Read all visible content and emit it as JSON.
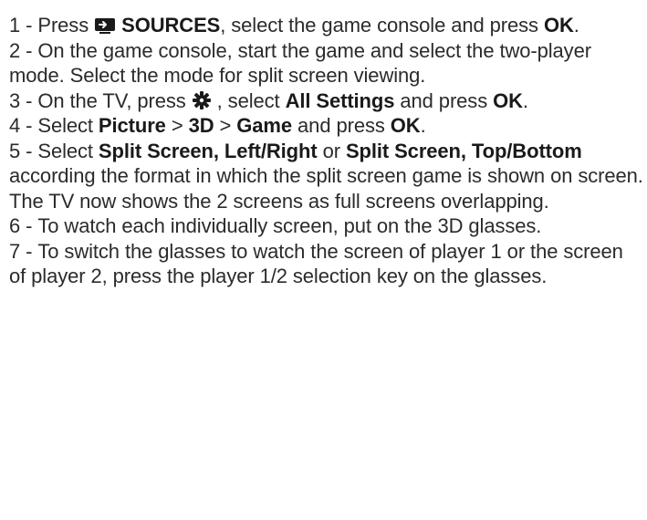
{
  "steps": [
    {
      "num": "1 -",
      "parts": {
        "a": "Press",
        "icon": "sources-icon",
        "b": "SOURCES",
        "c": ", select the game console and press",
        "d": "OK",
        "e": "."
      }
    },
    {
      "num": "2 -",
      "text": "On the game console, start the game and select the two-player mode. Select the mode for split screen viewing."
    },
    {
      "num": "3 -",
      "parts": {
        "a": "On the TV, press",
        "icon": "settings-gear-icon",
        "b": ", select",
        "c": "All Settings",
        "d": "and press",
        "e": "OK",
        "f": "."
      }
    },
    {
      "num": "4 -",
      "parts": {
        "a": "Select",
        "b": "Picture",
        "c": ">",
        "d": "3D",
        "e": ">",
        "f": "Game",
        "g": "and press",
        "h": "OK",
        "i": "."
      }
    },
    {
      "num": "5 -",
      "parts": {
        "a": "Select",
        "b": "Split Screen, Left/Right",
        "c": "or",
        "d": "Split Screen, Top/Bottom",
        "e": "according the format in which the split screen game is shown on screen. The TV now shows the 2 screens as full screens overlapping."
      }
    },
    {
      "num": "6 -",
      "text": "To watch each individually screen, put on the 3D glasses."
    },
    {
      "num": "7 -",
      "text": "To switch the glasses to watch the screen of player 1 or the screen of player 2, press the player 1/2 selection key on the glasses."
    }
  ]
}
